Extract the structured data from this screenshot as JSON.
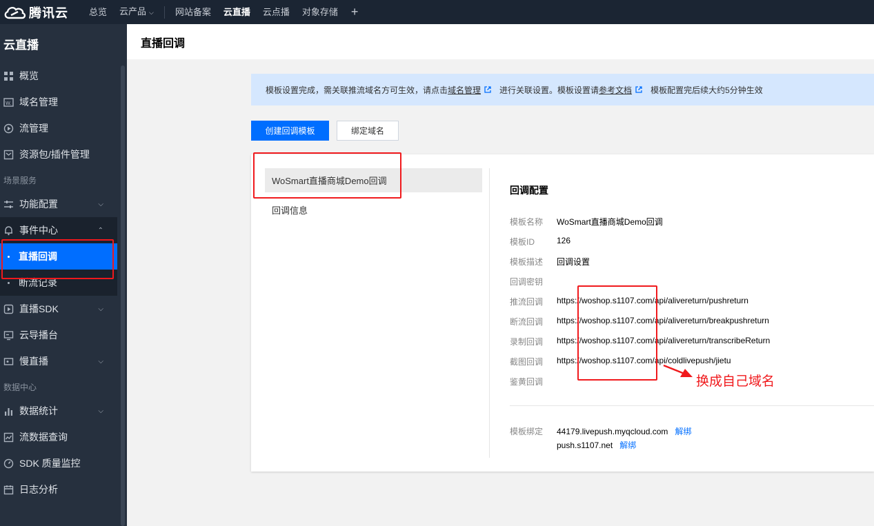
{
  "brand": {
    "name": "腾讯云"
  },
  "topnav": {
    "items": [
      "总览",
      "云产品",
      "网站备案",
      "云直播",
      "云点播",
      "对象存储"
    ],
    "active": "云直播"
  },
  "sidebar": {
    "title": "云直播",
    "items": {
      "overview": "概览",
      "domain": "域名管理",
      "stream": "流管理",
      "package": "资源包/插件管理",
      "group_scene": "场景服务",
      "feature": "功能配置",
      "event": "事件中心",
      "event_callback": "直播回调",
      "event_breakrecord": "断流记录",
      "sdk": "直播SDK",
      "director": "云导播台",
      "slow": "慢直播",
      "group_data": "数据中心",
      "stats": "数据统计",
      "flowquery": "流数据查询",
      "sdkmonitor": "SDK 质量监控",
      "log": "日志分析"
    }
  },
  "page": {
    "title": "直播回调"
  },
  "notice": {
    "text1": "模板设置完成，需关联推流域名方可生效，请点击",
    "link1": "域名管理",
    "text2": "进行关联设置。模板设置请",
    "link2": "参考文档",
    "text3": "模板配置完后续大约5分钟生效"
  },
  "buttons": {
    "create": "创建回调模板",
    "bind": "绑定域名"
  },
  "templates": {
    "selected": "WoSmart直播商城Demo回调",
    "sub": "回调信息"
  },
  "config": {
    "title": "回调配置",
    "rows": [
      {
        "label": "模板名称",
        "value": "WoSmart直播商城Demo回调"
      },
      {
        "label": "模板ID",
        "value": "126"
      },
      {
        "label": "模板描述",
        "value": "回调设置"
      },
      {
        "label": "回调密钥",
        "value": ""
      },
      {
        "label": "推流回调",
        "value": "https://woshop.s1107.com/api/alivereturn/pushreturn"
      },
      {
        "label": "断流回调",
        "value": "https://woshop.s1107.com/api/alivereturn/breakpushreturn"
      },
      {
        "label": "录制回调",
        "value": "https://woshop.s1107.com/api/alivereturn/transcribeReturn"
      },
      {
        "label": "截图回调",
        "value": "https://woshop.s1107.com/api/coldlivepush/jietu"
      },
      {
        "label": "鉴黄回调",
        "value": ""
      }
    ],
    "bind_label": "模板绑定",
    "bindings": [
      {
        "domain": "44179.livepush.myqcloud.com",
        "action": "解绑"
      },
      {
        "domain": "push.s1107.net",
        "action": "解绑"
      }
    ]
  },
  "annotation": {
    "text": "换成自己域名",
    "color": "#f0191c"
  },
  "colors": {
    "primary": "#006eff",
    "sidebar": "#26303e",
    "topbar": "#1b2533"
  }
}
